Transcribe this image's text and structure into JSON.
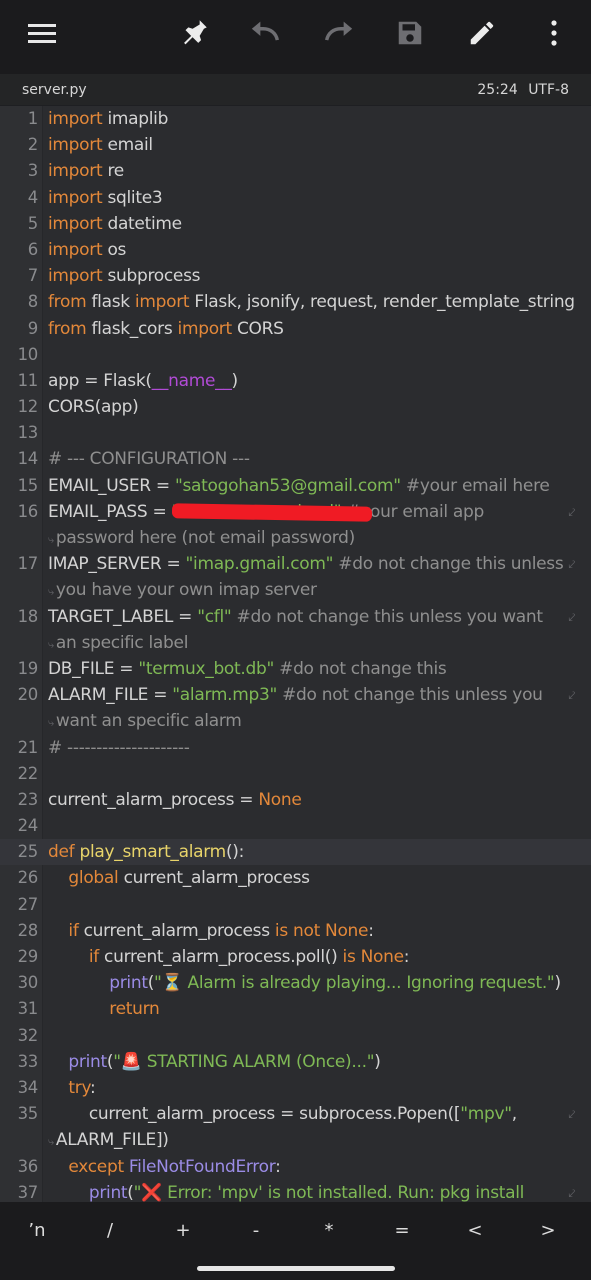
{
  "toolbar": {
    "icons": [
      "menu-icon",
      "pin-icon",
      "undo-icon",
      "redo-icon",
      "save-icon",
      "edit-icon",
      "more-vert-icon"
    ]
  },
  "file": {
    "name": "server.py",
    "cursor": "25:24",
    "encoding": "UTF-8"
  },
  "editor": {
    "current_line": 25,
    "lines": [
      {
        "n": "1",
        "segs": [
          {
            "t": "import",
            "c": "kw"
          },
          {
            "t": " imaplib"
          }
        ]
      },
      {
        "n": "2",
        "segs": [
          {
            "t": "import",
            "c": "kw"
          },
          {
            "t": " email"
          }
        ]
      },
      {
        "n": "3",
        "segs": [
          {
            "t": "import",
            "c": "kw"
          },
          {
            "t": " re"
          }
        ]
      },
      {
        "n": "4",
        "segs": [
          {
            "t": "import",
            "c": "kw"
          },
          {
            "t": " sqlite3"
          }
        ]
      },
      {
        "n": "5",
        "segs": [
          {
            "t": "import",
            "c": "kw"
          },
          {
            "t": " datetime"
          }
        ]
      },
      {
        "n": "6",
        "segs": [
          {
            "t": "import",
            "c": "kw"
          },
          {
            "t": " os"
          }
        ]
      },
      {
        "n": "7",
        "segs": [
          {
            "t": "import",
            "c": "kw"
          },
          {
            "t": " subprocess"
          }
        ]
      },
      {
        "n": "8",
        "segs": [
          {
            "t": "from",
            "c": "kw"
          },
          {
            "t": " flask "
          },
          {
            "t": "import",
            "c": "kw"
          },
          {
            "t": " Flask, jsonify, request, render_template_string"
          }
        ]
      },
      {
        "n": "9",
        "segs": [
          {
            "t": "from",
            "c": "kw"
          },
          {
            "t": " flask_cors "
          },
          {
            "t": "import",
            "c": "kw"
          },
          {
            "t": " CORS"
          }
        ]
      },
      {
        "n": "10",
        "segs": []
      },
      {
        "n": "11",
        "segs": [
          {
            "t": "app = Flask("
          },
          {
            "t": "__name__",
            "c": "dn"
          },
          {
            "t": ")"
          }
        ]
      },
      {
        "n": "12",
        "segs": [
          {
            "t": "CORS(app)"
          }
        ]
      },
      {
        "n": "13",
        "segs": []
      },
      {
        "n": "14",
        "segs": [
          {
            "t": "# --- CONFIGURATION ---",
            "c": "cm"
          }
        ]
      },
      {
        "n": "15",
        "segs": [
          {
            "t": "EMAIL_USER = "
          },
          {
            "t": "\"satogohan53@gmail.com\"",
            "c": "str"
          },
          {
            "t": " #your email here",
            "c": "cm"
          }
        ]
      },
      {
        "n": "16",
        "redact": true,
        "wrap": true,
        "segs": [
          {
            "t": "EMAIL_PASS = "
          },
          {
            "t": "\"                    mkmd\"",
            "c": "str"
          },
          {
            "t": " #your email app",
            "c": "cm"
          }
        ],
        "cont": [
          {
            "t": "password here (not email password)",
            "c": "cm"
          }
        ]
      },
      {
        "n": "17",
        "wrap": true,
        "segs": [
          {
            "t": "IMAP_SERVER = "
          },
          {
            "t": "\"imap.gmail.com\"",
            "c": "str"
          },
          {
            "t": " #do not change this unless",
            "c": "cm"
          }
        ],
        "cont": [
          {
            "t": "you have your own imap server",
            "c": "cm"
          }
        ]
      },
      {
        "n": "18",
        "wrap": true,
        "segs": [
          {
            "t": "TARGET_LABEL = "
          },
          {
            "t": "\"cfl\"",
            "c": "str"
          },
          {
            "t": " #do not change this unless you want",
            "c": "cm"
          }
        ],
        "cont": [
          {
            "t": "an specific label",
            "c": "cm"
          }
        ]
      },
      {
        "n": "19",
        "segs": [
          {
            "t": "DB_FILE = "
          },
          {
            "t": "\"termux_bot.db\"",
            "c": "str"
          },
          {
            "t": " #do not change this",
            "c": "cm"
          }
        ]
      },
      {
        "n": "20",
        "wrap": true,
        "segs": [
          {
            "t": "ALARM_FILE = "
          },
          {
            "t": "\"alarm.mp3\"",
            "c": "str"
          },
          {
            "t": " #do not change this unless you",
            "c": "cm"
          }
        ],
        "cont": [
          {
            "t": "want an specific alarm",
            "c": "cm"
          }
        ]
      },
      {
        "n": "21",
        "segs": [
          {
            "t": "# ---------------------",
            "c": "cm"
          }
        ]
      },
      {
        "n": "22",
        "segs": []
      },
      {
        "n": "23",
        "segs": [
          {
            "t": "current_alarm_process = "
          },
          {
            "t": "None",
            "c": "kw"
          }
        ]
      },
      {
        "n": "24",
        "segs": []
      },
      {
        "n": "25",
        "segs": [
          {
            "t": "def",
            "c": "kw"
          },
          {
            "t": " "
          },
          {
            "t": "play_smart_alarm",
            "c": "fn"
          },
          {
            "t": "():"
          }
        ]
      },
      {
        "n": "26",
        "segs": [
          {
            "t": "    "
          },
          {
            "t": "global",
            "c": "kw"
          },
          {
            "t": " current_alarm_process"
          }
        ]
      },
      {
        "n": "27",
        "segs": []
      },
      {
        "n": "28",
        "segs": [
          {
            "t": "    "
          },
          {
            "t": "if",
            "c": "kw"
          },
          {
            "t": " current_alarm_process "
          },
          {
            "t": "is not None",
            "c": "kw"
          },
          {
            "t": ":"
          }
        ]
      },
      {
        "n": "29",
        "segs": [
          {
            "t": "        "
          },
          {
            "t": "if",
            "c": "kw"
          },
          {
            "t": " current_alarm_process.poll() "
          },
          {
            "t": "is None",
            "c": "kw"
          },
          {
            "t": ":"
          }
        ]
      },
      {
        "n": "30",
        "segs": [
          {
            "t": "            "
          },
          {
            "t": "print",
            "c": "bi"
          },
          {
            "t": "("
          },
          {
            "t": "\"⏳ Alarm is already playing... Ignoring request.\"",
            "c": "str"
          },
          {
            "t": ")"
          }
        ]
      },
      {
        "n": "31",
        "segs": [
          {
            "t": "            "
          },
          {
            "t": "return",
            "c": "kw"
          }
        ]
      },
      {
        "n": "32",
        "segs": []
      },
      {
        "n": "33",
        "segs": [
          {
            "t": "    "
          },
          {
            "t": "print",
            "c": "bi"
          },
          {
            "t": "("
          },
          {
            "t": "\"🚨 STARTING ALARM (Once)...\"",
            "c": "str"
          },
          {
            "t": ")"
          }
        ]
      },
      {
        "n": "34",
        "segs": [
          {
            "t": "    "
          },
          {
            "t": "try",
            "c": "kw"
          },
          {
            "t": ":"
          }
        ]
      },
      {
        "n": "35",
        "wrap": true,
        "segs": [
          {
            "t": "        current_alarm_process = subprocess.Popen(["
          },
          {
            "t": "\"mpv\"",
            "c": "str"
          },
          {
            "t": ","
          }
        ],
        "cont": [
          {
            "t": "ALARM_FILE])"
          }
        ]
      },
      {
        "n": "36",
        "segs": [
          {
            "t": "    "
          },
          {
            "t": "except",
            "c": "kw"
          },
          {
            "t": " "
          },
          {
            "t": "FileNotFoundError",
            "c": "bi"
          },
          {
            "t": ":"
          }
        ]
      },
      {
        "n": "37",
        "wrap": true,
        "segs": [
          {
            "t": "        "
          },
          {
            "t": "print",
            "c": "bi"
          },
          {
            "t": "("
          },
          {
            "t": "\"❌ Error: 'mpv' is not installed. Run: pkg install",
            "c": "str"
          }
        ],
        "cont": []
      }
    ]
  },
  "keys": [
    "\\n",
    "/",
    "+",
    "-",
    "*",
    "=",
    "<",
    ">"
  ]
}
